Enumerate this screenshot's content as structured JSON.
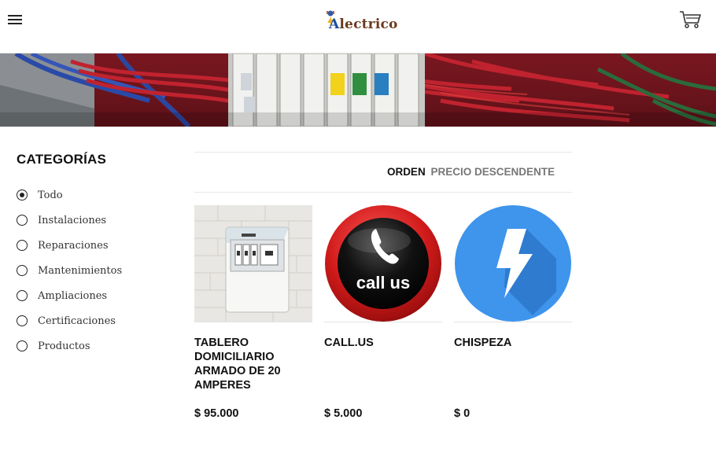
{
  "header": {
    "logo_text": "Alectrico",
    "menu_icon": "hamburger-menu-icon",
    "cart_icon": "shopping-cart-icon"
  },
  "sidebar": {
    "title": "CATEGORÍAS",
    "items": [
      {
        "label": "Todo",
        "selected": true
      },
      {
        "label": "Instalaciones",
        "selected": false
      },
      {
        "label": "Reparaciones",
        "selected": false
      },
      {
        "label": "Mantenimientos",
        "selected": false
      },
      {
        "label": "Ampliaciones",
        "selected": false
      },
      {
        "label": "Certificaciones",
        "selected": false
      },
      {
        "label": "Productos",
        "selected": false
      }
    ]
  },
  "sort": {
    "label": "ORDEN",
    "value": "PRECIO DESCENDENTE"
  },
  "products": [
    {
      "name": "TABLERO DOMICILIARIO ARMADO DE 20 AMPERES",
      "price": "$ 95.000",
      "image": "electrical-panel-image"
    },
    {
      "name": "CALL.US",
      "price": "$ 5.000",
      "image": "call-us-button-image"
    },
    {
      "name": "CHISPEZA",
      "price": "$ 0",
      "image": "lightning-bolt-image"
    }
  ],
  "colors": {
    "banner_wire_red": "#b3202c",
    "sort_value": "#777777",
    "bolt_circle": "#3f94ec"
  }
}
